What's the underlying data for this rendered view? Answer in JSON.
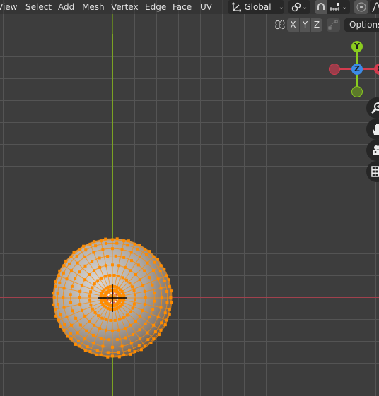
{
  "header": {
    "menus": [
      "View",
      "Select",
      "Add",
      "Mesh",
      "Vertex",
      "Edge",
      "Face",
      "UV"
    ],
    "transform_orientation": "Global",
    "transform_orientation_icon": "orientation-axes-icon",
    "pivot_icon": "pivot-link-icon",
    "snap_icon": "snap-magnet-icon",
    "snap_target_icon": "snap-increment-icon",
    "proportional_icon": "proportional-edit-icon",
    "falloff_icon": "falloff-curve-icon"
  },
  "subtoolbar": {
    "mirror_icon": "mirror-butterfly-icon",
    "axes": [
      "X",
      "Y",
      "Z"
    ],
    "auto_merge_icon": "auto-merge-icon",
    "options_label": "Options"
  },
  "gizmo": {
    "y_label": "Y",
    "z_label": "Z",
    "x_label": "X",
    "colors": {
      "x": "#d33c4f",
      "y": "#8acc1f",
      "z": "#3c8ae6"
    }
  },
  "nav_buttons": [
    {
      "name": "zoom-button",
      "icon": "zoom-magnifier-icon"
    },
    {
      "name": "pan-button",
      "icon": "hand-icon"
    },
    {
      "name": "camera-button",
      "icon": "camera-icon"
    },
    {
      "name": "ortho-toggle-button",
      "icon": "grid-icon"
    }
  ],
  "mesh": {
    "object": "UV Sphere",
    "mode": "Edit Mode",
    "selection": "all vertices selected",
    "selection_color": "#ff8c00",
    "segments": 32,
    "rings": 16
  },
  "colors": {
    "background": "#3d3d3d",
    "grid": "#545454",
    "x_axis": "#a0414d",
    "y_axis": "#7ba223"
  }
}
